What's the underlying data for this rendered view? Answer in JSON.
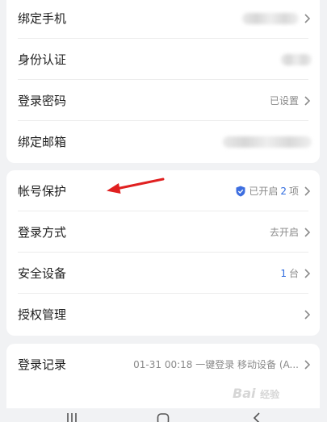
{
  "account_card": {
    "rows": [
      {
        "label": "绑定手机",
        "value": ""
      },
      {
        "label": "身份认证",
        "value": ""
      },
      {
        "label": "登录密码",
        "value": "已设置"
      },
      {
        "label": "绑定邮箱",
        "value": ""
      }
    ]
  },
  "security_card": {
    "protection": {
      "label": "帐号保护",
      "value_prefix": "已开启",
      "count": "2",
      "value_suffix": "项"
    },
    "login_method": {
      "label": "登录方式",
      "value": "去开启"
    },
    "devices": {
      "label": "安全设备",
      "count": "1",
      "value_suffix": "台"
    },
    "authorization": {
      "label": "授权管理",
      "value": ""
    }
  },
  "records_card": {
    "login_records": {
      "label": "登录记录",
      "value": "01-31 00:18 一键登录 移动设备 (A..."
    }
  },
  "watermark": {
    "text": "Bai",
    "suffix": "经验"
  },
  "colors": {
    "accent_blue": "#2f6bdf",
    "arrow_red": "#e02020",
    "shield_blue": "#3d6ee0"
  },
  "icons": [
    "chevron-right-icon",
    "shield-check-icon",
    "red-arrow-annotation",
    "recent-apps-icon",
    "home-icon",
    "back-icon"
  ]
}
